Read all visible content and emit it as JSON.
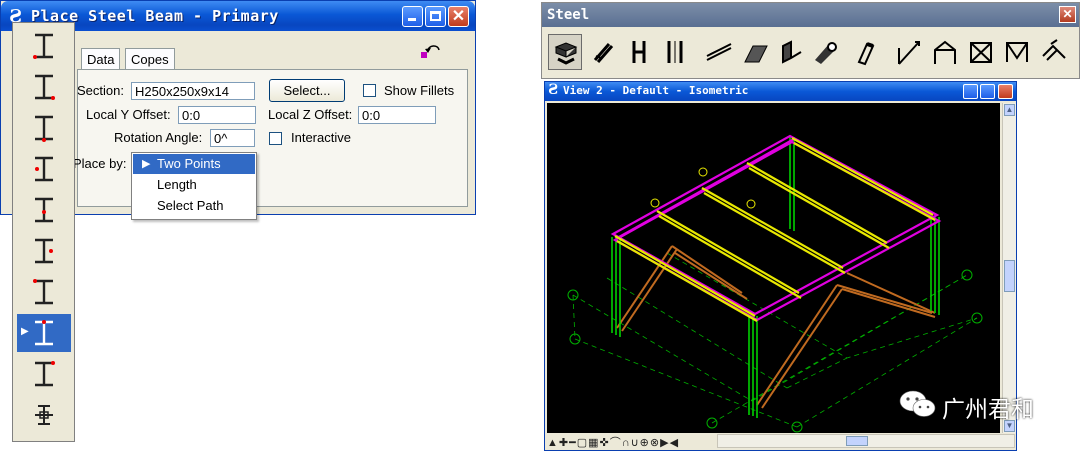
{
  "place_beam_dialog": {
    "title": "Place Steel Beam - Primary",
    "tabs": [
      "Data",
      "Copes"
    ],
    "section_label": "Section:",
    "section_value": "H250x250x9x14",
    "select_button": "Select...",
    "show_fillets_label": "Show Fillets",
    "local_y_label": "Local Y Offset:",
    "local_y_value": "0:0",
    "local_z_label": "Local Z Offset:",
    "local_z_value": "0:0",
    "rotation_label": "Rotation Angle:",
    "rotation_value": "0^",
    "interactive_label": "Interactive",
    "place_by_label": "Place by:",
    "place_by_options": [
      "Two Points",
      "Length",
      "Select Path"
    ],
    "place_by_selected": "Two Points"
  },
  "beam_tools": {
    "icons": [
      "beam-top-left-icon",
      "beam-bottom-left-icon",
      "beam-centroid-icon",
      "beam-middle-left-icon",
      "beam-bottom-center-icon",
      "beam-middle-right-icon",
      "beam-top-left-alt-icon",
      "beam-top-center-icon",
      "beam-bottom-right-icon",
      "beam-cross-section-icon"
    ],
    "active_index": 7
  },
  "steel_toolbar": {
    "title": "Steel",
    "tools": [
      "place-beam-icon",
      "place-column-icon",
      "place-member-icon",
      "place-plate-member-icon",
      "place-brace-icon",
      "place-purlin-icon",
      "place-angle-icon",
      "place-pipe-icon",
      "place-bar-icon",
      "place-roof-icon",
      "place-gable-icon",
      "place-truss-icon",
      "place-portal-icon",
      "place-stair-icon"
    ],
    "active_index": 0
  },
  "view_window": {
    "title": "View 2 - Default - Isometric",
    "colors": {
      "background": "#000000",
      "beam_primary": "#e000e0",
      "beam_secondary": "#e8e800",
      "column": "#00d000",
      "brace": "#c06a20",
      "grid": "#00b000"
    }
  },
  "watermark": {
    "text": "广州君和"
  }
}
